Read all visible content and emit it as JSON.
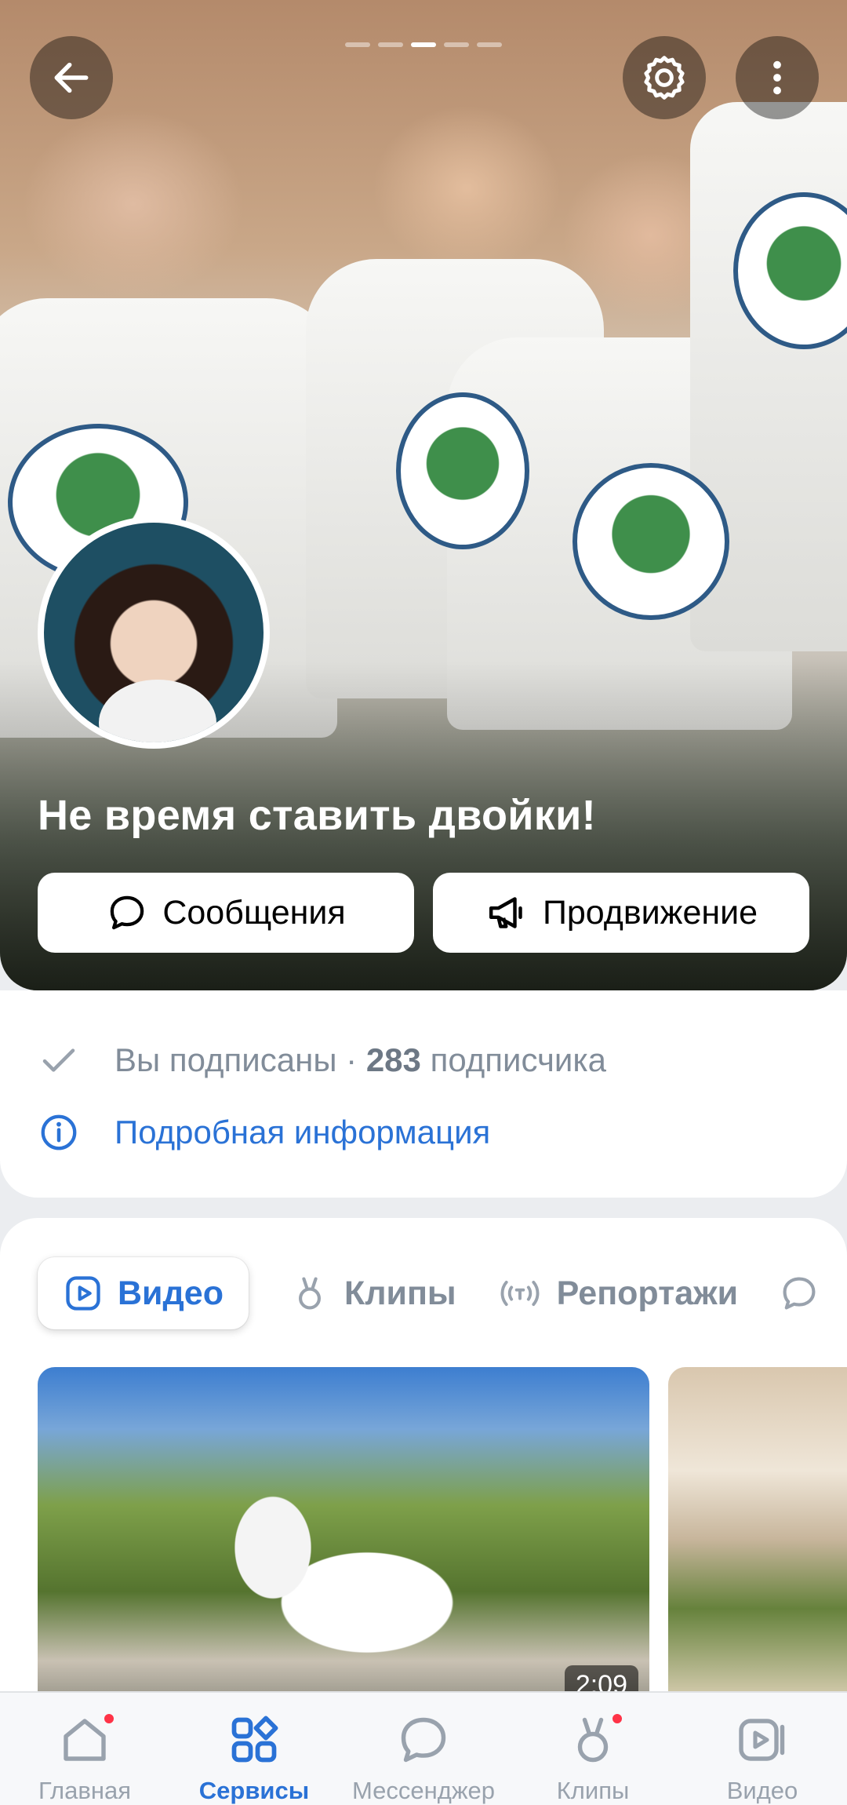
{
  "header": {
    "story_count": 5,
    "story_active_index": 2,
    "icons": {
      "back": "arrow-left-icon",
      "settings": "gear-icon",
      "more": "more-vertical-icon"
    }
  },
  "group": {
    "title": "Не время ставить двойки!",
    "messages_label": "Сообщения",
    "promotion_label": "Продвижение"
  },
  "info": {
    "subscribed_text": "Вы подписаны · ",
    "subscriber_count": "283",
    "subscriber_word": " подписчика",
    "details_label": "Подробная информация"
  },
  "content": {
    "tabs": [
      {
        "label": "Видео",
        "icon": "video-play-icon",
        "active": true
      },
      {
        "label": "Клипы",
        "icon": "clips-icon",
        "active": false
      },
      {
        "label": "Репортажи",
        "icon": "broadcast-icon",
        "active": false
      }
    ],
    "videos": [
      {
        "duration": "2:09"
      }
    ]
  },
  "nav": {
    "items": [
      {
        "label": "Главная",
        "icon": "home-icon",
        "badge": true,
        "active": false
      },
      {
        "label": "Сервисы",
        "icon": "services-icon",
        "badge": false,
        "active": true
      },
      {
        "label": "Мессенджер",
        "icon": "messenger-icon",
        "badge": false,
        "active": false
      },
      {
        "label": "Клипы",
        "icon": "clips-icon",
        "badge": true,
        "active": false
      },
      {
        "label": "Видео",
        "icon": "video-icon",
        "badge": false,
        "active": false
      }
    ]
  },
  "colors": {
    "accent": "#2a72d6",
    "badge": "#ff3347",
    "secondary_text": "#818c99",
    "background": "#ebedf0"
  }
}
